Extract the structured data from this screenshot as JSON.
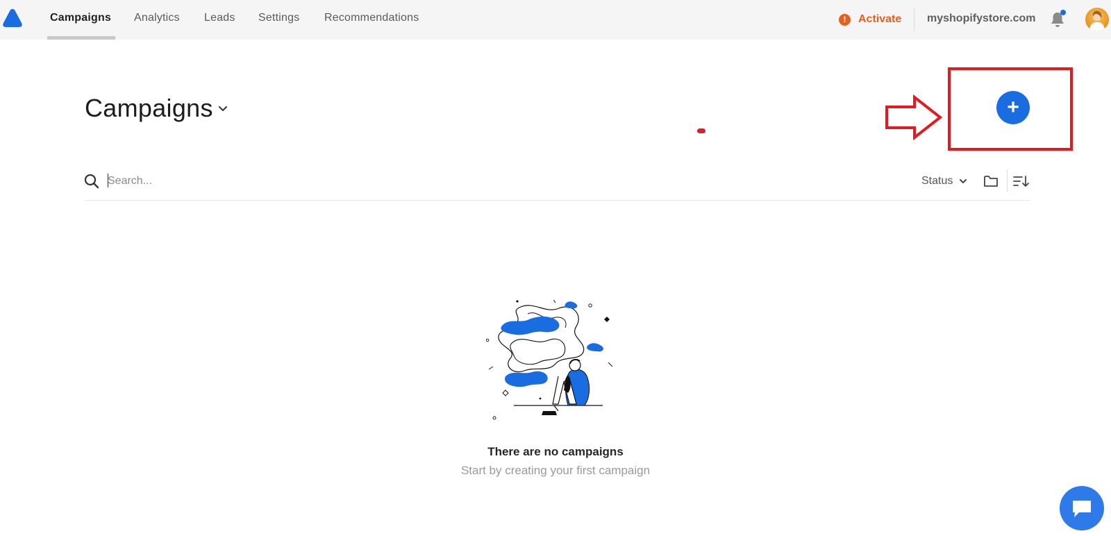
{
  "nav": {
    "items": [
      {
        "label": "Campaigns",
        "active": true
      },
      {
        "label": "Analytics",
        "active": false
      },
      {
        "label": "Leads",
        "active": false
      },
      {
        "label": "Settings",
        "active": false
      },
      {
        "label": "Recommendations",
        "active": false
      }
    ],
    "activate_label": "Activate",
    "store_name": "myshopifystore.com",
    "icons": {
      "logo": "logo-icon",
      "warning": "warning-icon",
      "bell": "bell-icon",
      "avatar": "avatar"
    }
  },
  "header": {
    "title": "Campaigns",
    "add_button_glyph": "+"
  },
  "toolbar": {
    "search_placeholder": "Search...",
    "status_label": "Status",
    "icons": [
      "search-icon",
      "chevron-down-icon",
      "folder-icon",
      "sort-icon"
    ]
  },
  "empty_state": {
    "title": "There are no campaigns",
    "subtitle": "Start by creating your first campaign"
  },
  "colors": {
    "accent": "#1a6de0",
    "activate": "#e8601c",
    "annotation": "#e21b23",
    "chat": "#2d7ae8"
  }
}
